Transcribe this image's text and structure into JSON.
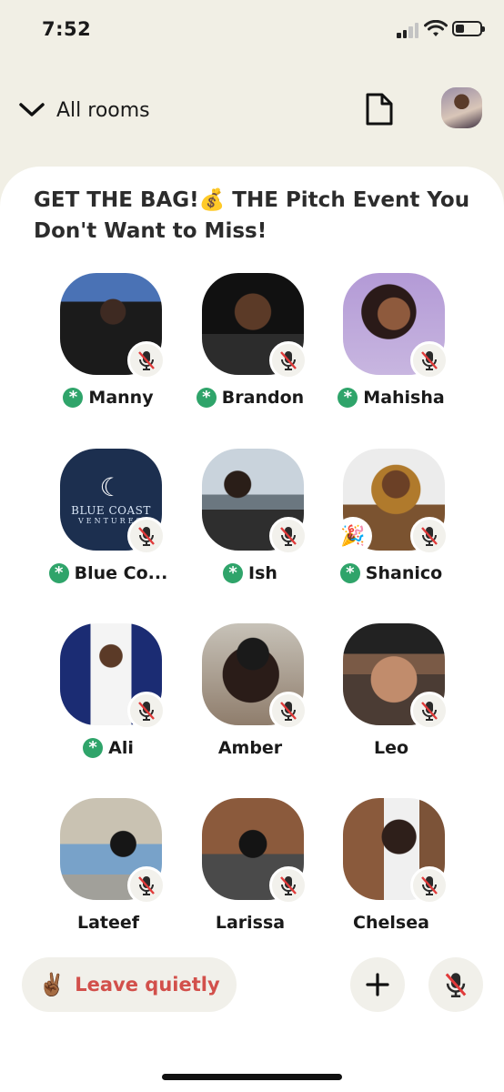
{
  "status_bar": {
    "time": "7:52"
  },
  "nav": {
    "back_label": "All rooms"
  },
  "room": {
    "title": "GET THE BAG!💰 THE Pitch Event You Don't Want to Miss!"
  },
  "speakers": [
    {
      "name": "Manny",
      "moderator": true,
      "muted": true
    },
    {
      "name": "Brandon",
      "moderator": true,
      "muted": true
    },
    {
      "name": "Mahisha",
      "moderator": true,
      "muted": true
    },
    {
      "name": "Blue Co...",
      "moderator": true,
      "muted": true,
      "logo_line1": "BLUE COAST",
      "logo_line2": "VENTURES"
    },
    {
      "name": "Ish",
      "moderator": true,
      "muted": true
    },
    {
      "name": "Shanico",
      "moderator": true,
      "muted": true,
      "new_user_badge": "🎉"
    },
    {
      "name": "Ali",
      "moderator": true,
      "muted": true
    },
    {
      "name": "Amber",
      "moderator": false,
      "muted": true
    },
    {
      "name": "Leo",
      "moderator": false,
      "muted": true
    },
    {
      "name": "Lateef",
      "moderator": false,
      "muted": true
    },
    {
      "name": "Larissa",
      "moderator": false,
      "muted": true
    },
    {
      "name": "Chelsea",
      "moderator": false,
      "muted": true
    }
  ],
  "footer": {
    "leave_emoji": "✌🏾",
    "leave_label": "Leave quietly",
    "add_icon": "plus-icon",
    "mute_icon": "mic-muted-icon"
  },
  "colors": {
    "background": "#f1efe5",
    "moderator_green": "#2fa46a",
    "leave_red": "#d2504b"
  }
}
